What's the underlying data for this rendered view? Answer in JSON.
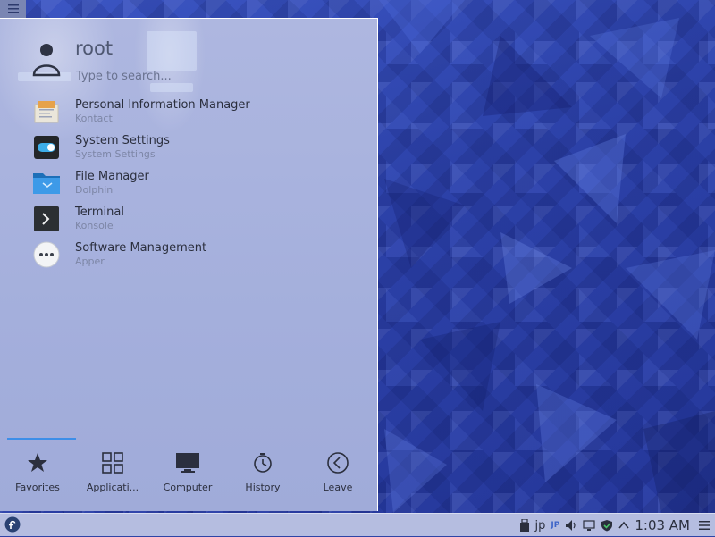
{
  "desktop": {
    "toolbox_icon": "hamburger-icon"
  },
  "launcher": {
    "user": {
      "name": "root",
      "avatar_icon": "user-icon"
    },
    "search": {
      "placeholder": "Type to search..."
    },
    "favorites": [
      {
        "title": "Personal Information Manager",
        "subtitle": "Kontact",
        "icon": "kontact-icon"
      },
      {
        "title": "System Settings",
        "subtitle": "System Settings",
        "icon": "system-settings-icon"
      },
      {
        "title": "File Manager",
        "subtitle": "Dolphin",
        "icon": "folder-icon"
      },
      {
        "title": "Terminal",
        "subtitle": "Konsole",
        "icon": "terminal-icon"
      },
      {
        "title": "Software Management",
        "subtitle": "Apper",
        "icon": "apper-icon"
      }
    ],
    "tabs": [
      {
        "label": "Favorites",
        "icon": "star-icon",
        "active": true
      },
      {
        "label": "Applicati...",
        "icon": "grid-icon",
        "active": false
      },
      {
        "label": "Computer",
        "icon": "monitor-icon",
        "active": false
      },
      {
        "label": "History",
        "icon": "history-icon",
        "active": false
      },
      {
        "label": "Leave",
        "icon": "back-arrow-icon",
        "active": false
      }
    ],
    "accent_color": "#3d8ee8"
  },
  "panel": {
    "launcher_icon": "fedora-icon",
    "tray": {
      "usb_icon": "usb-icon",
      "keyboard_layout": "jp",
      "input_method": "JP",
      "volume_icon": "volume-icon",
      "display_icon": "display-icon",
      "updates_icon": "shield-icon",
      "expand_icon": "chevron-up-icon",
      "clock": "1:03 AM",
      "menu_icon": "hamburger-icon"
    }
  }
}
